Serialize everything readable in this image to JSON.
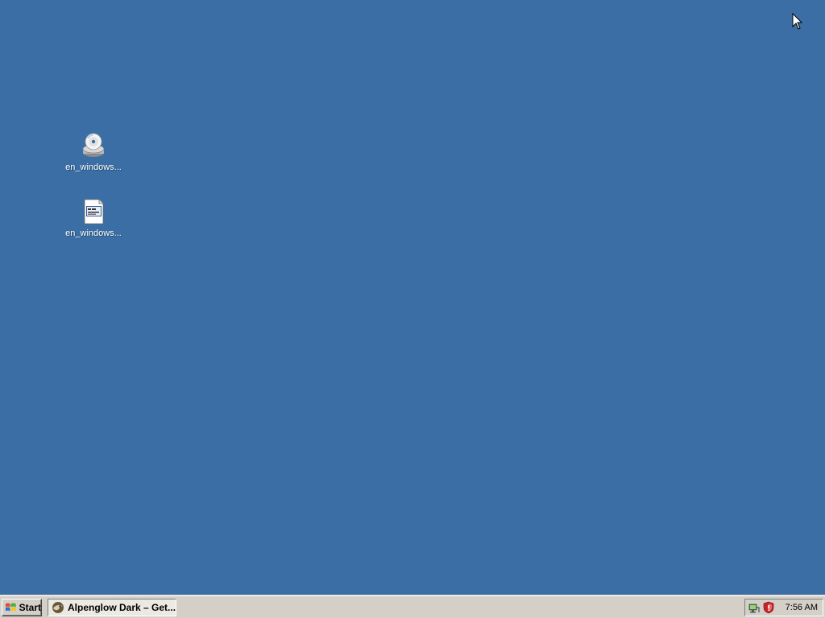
{
  "desktop": {
    "background_color": "#3a6ea5",
    "icons": [
      {
        "label": "en_windows...",
        "icon": "cd-drive-icon"
      },
      {
        "label": "en_windows...",
        "icon": "text-document-icon"
      }
    ]
  },
  "taskbar": {
    "start_label": "Start",
    "tasks": [
      {
        "label": "Alpenglow Dark – Get...",
        "icon": "browser-app-icon"
      }
    ],
    "tray": {
      "icons": [
        "network-icon",
        "security-shield-icon"
      ],
      "clock": "7:56 AM"
    }
  }
}
